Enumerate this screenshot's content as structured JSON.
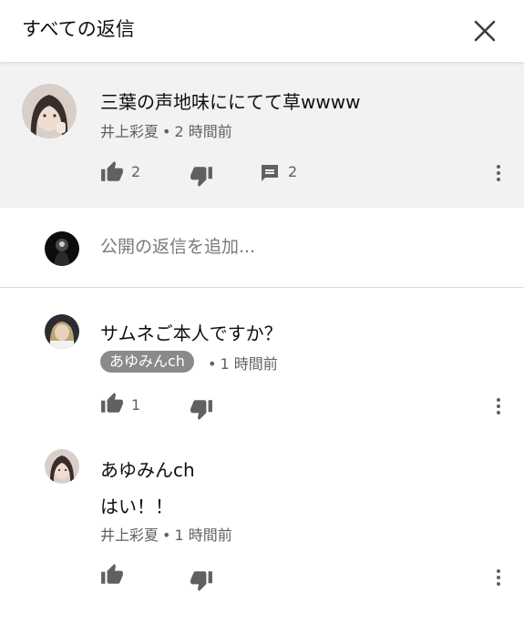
{
  "header": {
    "title": "すべての返信",
    "close_icon": "close-icon"
  },
  "parent_comment": {
    "text": "三葉の声地味ににてて草wwww",
    "author": "井上彩夏",
    "time": "2 時間前",
    "like_count": "2",
    "reply_count": "2"
  },
  "add_reply": {
    "placeholder": "公開の返信を追加..."
  },
  "replies": [
    {
      "text": "サムネご本人ですか？",
      "author_chip": "あゆみんch",
      "time": "1 時間前",
      "like_count": "1"
    },
    {
      "text_line1": "あゆみんch",
      "text_line2": "はい！！",
      "author": "井上彩夏",
      "time": "1 時間前"
    }
  ],
  "separator": "•",
  "colors": {
    "header_bg": "#ffffff",
    "highlight_bg": "#f2f2f2",
    "meta": "#606060",
    "chip_bg": "#8a8a8a"
  }
}
